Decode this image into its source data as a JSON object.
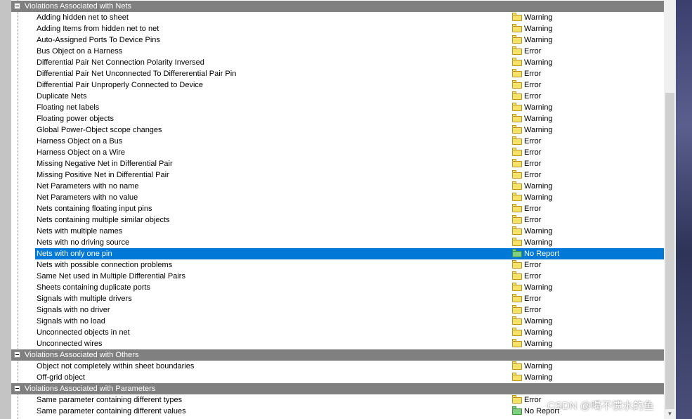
{
  "groups": [
    {
      "title": "Violations Associated with Nets",
      "items": [
        {
          "name": "Adding hidden net to sheet",
          "severity": "Warning"
        },
        {
          "name": "Adding Items from hidden net to net",
          "severity": "Warning"
        },
        {
          "name": "Auto-Assigned Ports To Device Pins",
          "severity": "Warning"
        },
        {
          "name": "Bus Object on a Harness",
          "severity": "Error"
        },
        {
          "name": "Differential Pair Net Connection Polarity Inversed",
          "severity": "Warning"
        },
        {
          "name": "Differential Pair Net Unconnected To Differerential Pair Pin",
          "severity": "Error"
        },
        {
          "name": "Differential Pair Unproperly Connected to Device",
          "severity": "Error"
        },
        {
          "name": "Duplicate Nets",
          "severity": "Error"
        },
        {
          "name": "Floating net labels",
          "severity": "Warning"
        },
        {
          "name": "Floating power objects",
          "severity": "Warning"
        },
        {
          "name": "Global Power-Object scope changes",
          "severity": "Warning"
        },
        {
          "name": "Harness Object on a Bus",
          "severity": "Error"
        },
        {
          "name": "Harness Object on a Wire",
          "severity": "Error"
        },
        {
          "name": "Missing Negative Net in Differential Pair",
          "severity": "Error"
        },
        {
          "name": "Missing Positive Net in Differential Pair",
          "severity": "Error"
        },
        {
          "name": "Net Parameters with no name",
          "severity": "Warning"
        },
        {
          "name": "Net Parameters with no value",
          "severity": "Warning"
        },
        {
          "name": "Nets containing floating input pins",
          "severity": "Error"
        },
        {
          "name": "Nets containing multiple similar objects",
          "severity": "Error"
        },
        {
          "name": "Nets with multiple names",
          "severity": "Warning"
        },
        {
          "name": "Nets with no driving source",
          "severity": "Warning"
        },
        {
          "name": "Nets with only one pin",
          "severity": "No Report",
          "selected": true
        },
        {
          "name": "Nets with possible connection problems",
          "severity": "Error"
        },
        {
          "name": "Same Net used in Multiple Differential Pairs",
          "severity": "Error"
        },
        {
          "name": "Sheets containing duplicate ports",
          "severity": "Warning"
        },
        {
          "name": "Signals with multiple drivers",
          "severity": "Error"
        },
        {
          "name": "Signals with no driver",
          "severity": "Error"
        },
        {
          "name": "Signals with no load",
          "severity": "Warning"
        },
        {
          "name": "Unconnected objects in net",
          "severity": "Warning"
        },
        {
          "name": "Unconnected wires",
          "severity": "Warning"
        }
      ]
    },
    {
      "title": "Violations Associated with Others",
      "items": [
        {
          "name": "Object not completely within sheet boundaries",
          "severity": "Warning"
        },
        {
          "name": "Off-grid object",
          "severity": "Warning"
        }
      ]
    },
    {
      "title": "Violations Associated with Parameters",
      "items": [
        {
          "name": "Same parameter containing different types",
          "severity": "Error"
        },
        {
          "name": "Same parameter containing different values",
          "severity": "No Report"
        }
      ]
    }
  ],
  "watermark": "CSDN @喝不惯水的鱼",
  "colors": {
    "group_header_bg": "#808080",
    "selection_bg": "#0078d7",
    "folder_yellow": "#fde26a",
    "folder_green": "#7fcf7f"
  },
  "icons": {
    "group_toggle": "collapse-minus-icon",
    "severity_folder": "folder-icon",
    "no_report_folder": "green-folder-icon"
  }
}
